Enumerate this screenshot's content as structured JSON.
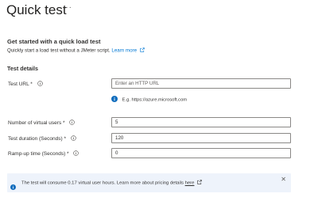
{
  "header": {
    "title": "Quick test",
    "more_label": "···"
  },
  "intro": {
    "heading": "Get started with a quick load test",
    "description": "Quickly start a load test without a JMeter script.",
    "learn_more": "Learn more"
  },
  "section": {
    "title": "Test details"
  },
  "fields": {
    "test_url": {
      "label": "Test URL *",
      "placeholder": "Enter an HTTP URL",
      "value": "",
      "hint": "E.g. https://azure.microsoft.com"
    },
    "virtual_users": {
      "label": "Number of virtual users *",
      "value": "5"
    },
    "test_duration": {
      "label": "Test duration (Seconds) *",
      "value": "120"
    },
    "ramp_up": {
      "label": "Ramp-up time (Seconds) *",
      "value": "0"
    }
  },
  "banner": {
    "text": "The test will consume 0.17 virtual user hours. Learn more about pricing details",
    "link": "here",
    "close_label": "✕"
  },
  "colors": {
    "accent": "#0078d4",
    "banner_bg": "#eef3fb",
    "info_icon": "#0f6cbd"
  }
}
